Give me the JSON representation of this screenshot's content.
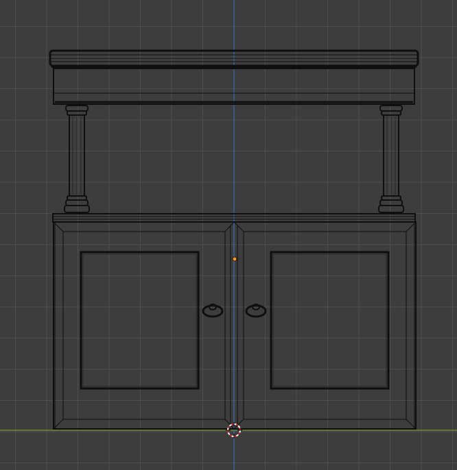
{
  "viewport": {
    "grid_color": "#505050",
    "background_color": "#3d3d3d",
    "axis_x_color": "#6f9a2e",
    "axis_y_color": "#2f6fb8",
    "origin_dot_color": "#ff9a1a",
    "cursor_color": "#ffffff",
    "cursor_accent_color": "#d02020"
  },
  "object": {
    "name": "cabinet",
    "mode": "wireframe"
  }
}
